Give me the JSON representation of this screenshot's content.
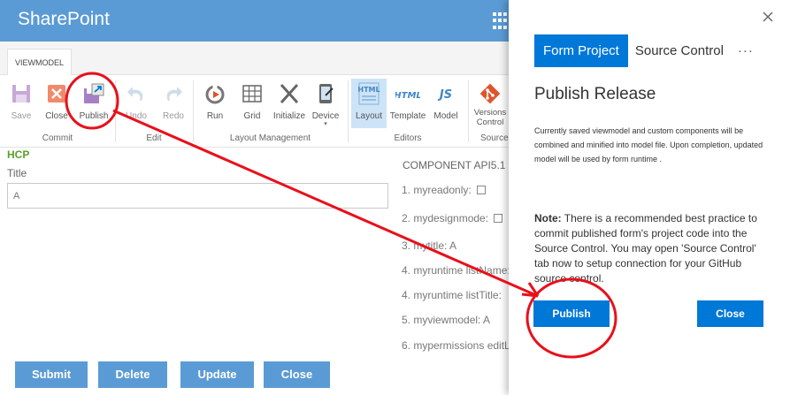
{
  "app": {
    "title": "SharePoint"
  },
  "ribbon": {
    "tab_label": "VIEWMODEL",
    "buttons": {
      "save": "Save",
      "close": "Close",
      "publish": "Publish",
      "undo": "Undo",
      "redo": "Redo",
      "run": "Run",
      "grid": "Grid",
      "initialize": "Initialize",
      "device": "Device",
      "layout": "Layout",
      "template": "Template",
      "model": "Model",
      "versions_line1": "Versions",
      "versions_line2": "Control"
    },
    "groups": {
      "commit": "Commit",
      "edit": "Edit",
      "layout_management": "Layout Management",
      "editors": "Editors",
      "source": "Source"
    }
  },
  "form": {
    "section": "HCP",
    "title_label": "Title",
    "title_value": "A",
    "component_header": "COMPONENT API5.1",
    "items": [
      "1. myreadonly:",
      "2. mydesignmode:",
      "3. mytitle: A",
      "4. myruntime listName:",
      "4. myruntime listTitle:",
      "5. myviewmodel: A",
      "6. mypermissions editL"
    ],
    "buttons": {
      "submit": "Submit",
      "delete": "Delete",
      "update": "Update",
      "close": "Close"
    }
  },
  "panel": {
    "tabs": {
      "form_project": "Form Project",
      "source_control": "Source Control",
      "more": "···"
    },
    "heading": "Publish Release",
    "description": "Currently saved viewmodel and custom components will be combined and minified into model file. Upon completion, updated model will be used by form runtime .",
    "note_label": "Note:",
    "note_text": " There is a recommended best practice to commit published form's project code into the Source Control. You may open 'Source Control' tab now to setup connection for your GitHub source control.",
    "publish_button": "Publish",
    "close_button": "Close"
  },
  "colors": {
    "suite_bar": "#5b9bd5",
    "primary": "#0078d7",
    "annotation": "#e8101a",
    "accent_green": "#5aa02c"
  }
}
